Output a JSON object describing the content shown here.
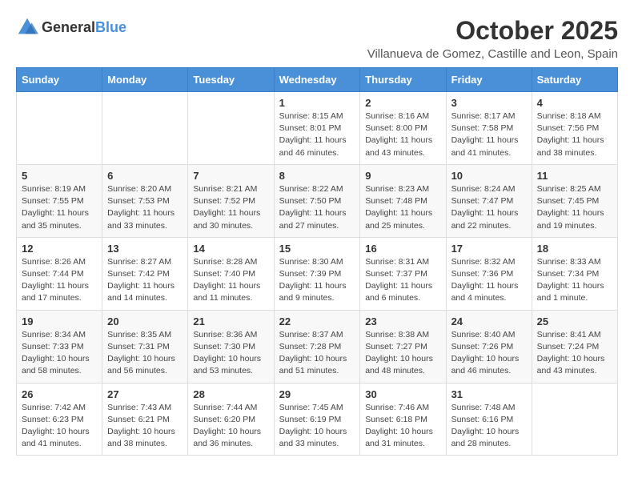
{
  "logo": {
    "general": "General",
    "blue": "Blue"
  },
  "header": {
    "month": "October 2025",
    "location": "Villanueva de Gomez, Castille and Leon, Spain"
  },
  "weekdays": [
    "Sunday",
    "Monday",
    "Tuesday",
    "Wednesday",
    "Thursday",
    "Friday",
    "Saturday"
  ],
  "weeks": [
    [
      {
        "day": "",
        "content": ""
      },
      {
        "day": "",
        "content": ""
      },
      {
        "day": "",
        "content": ""
      },
      {
        "day": "1",
        "content": "Sunrise: 8:15 AM\nSunset: 8:01 PM\nDaylight: 11 hours and 46 minutes."
      },
      {
        "day": "2",
        "content": "Sunrise: 8:16 AM\nSunset: 8:00 PM\nDaylight: 11 hours and 43 minutes."
      },
      {
        "day": "3",
        "content": "Sunrise: 8:17 AM\nSunset: 7:58 PM\nDaylight: 11 hours and 41 minutes."
      },
      {
        "day": "4",
        "content": "Sunrise: 8:18 AM\nSunset: 7:56 PM\nDaylight: 11 hours and 38 minutes."
      }
    ],
    [
      {
        "day": "5",
        "content": "Sunrise: 8:19 AM\nSunset: 7:55 PM\nDaylight: 11 hours and 35 minutes."
      },
      {
        "day": "6",
        "content": "Sunrise: 8:20 AM\nSunset: 7:53 PM\nDaylight: 11 hours and 33 minutes."
      },
      {
        "day": "7",
        "content": "Sunrise: 8:21 AM\nSunset: 7:52 PM\nDaylight: 11 hours and 30 minutes."
      },
      {
        "day": "8",
        "content": "Sunrise: 8:22 AM\nSunset: 7:50 PM\nDaylight: 11 hours and 27 minutes."
      },
      {
        "day": "9",
        "content": "Sunrise: 8:23 AM\nSunset: 7:48 PM\nDaylight: 11 hours and 25 minutes."
      },
      {
        "day": "10",
        "content": "Sunrise: 8:24 AM\nSunset: 7:47 PM\nDaylight: 11 hours and 22 minutes."
      },
      {
        "day": "11",
        "content": "Sunrise: 8:25 AM\nSunset: 7:45 PM\nDaylight: 11 hours and 19 minutes."
      }
    ],
    [
      {
        "day": "12",
        "content": "Sunrise: 8:26 AM\nSunset: 7:44 PM\nDaylight: 11 hours and 17 minutes."
      },
      {
        "day": "13",
        "content": "Sunrise: 8:27 AM\nSunset: 7:42 PM\nDaylight: 11 hours and 14 minutes."
      },
      {
        "day": "14",
        "content": "Sunrise: 8:28 AM\nSunset: 7:40 PM\nDaylight: 11 hours and 11 minutes."
      },
      {
        "day": "15",
        "content": "Sunrise: 8:30 AM\nSunset: 7:39 PM\nDaylight: 11 hours and 9 minutes."
      },
      {
        "day": "16",
        "content": "Sunrise: 8:31 AM\nSunset: 7:37 PM\nDaylight: 11 hours and 6 minutes."
      },
      {
        "day": "17",
        "content": "Sunrise: 8:32 AM\nSunset: 7:36 PM\nDaylight: 11 hours and 4 minutes."
      },
      {
        "day": "18",
        "content": "Sunrise: 8:33 AM\nSunset: 7:34 PM\nDaylight: 11 hours and 1 minute."
      }
    ],
    [
      {
        "day": "19",
        "content": "Sunrise: 8:34 AM\nSunset: 7:33 PM\nDaylight: 10 hours and 58 minutes."
      },
      {
        "day": "20",
        "content": "Sunrise: 8:35 AM\nSunset: 7:31 PM\nDaylight: 10 hours and 56 minutes."
      },
      {
        "day": "21",
        "content": "Sunrise: 8:36 AM\nSunset: 7:30 PM\nDaylight: 10 hours and 53 minutes."
      },
      {
        "day": "22",
        "content": "Sunrise: 8:37 AM\nSunset: 7:28 PM\nDaylight: 10 hours and 51 minutes."
      },
      {
        "day": "23",
        "content": "Sunrise: 8:38 AM\nSunset: 7:27 PM\nDaylight: 10 hours and 48 minutes."
      },
      {
        "day": "24",
        "content": "Sunrise: 8:40 AM\nSunset: 7:26 PM\nDaylight: 10 hours and 46 minutes."
      },
      {
        "day": "25",
        "content": "Sunrise: 8:41 AM\nSunset: 7:24 PM\nDaylight: 10 hours and 43 minutes."
      }
    ],
    [
      {
        "day": "26",
        "content": "Sunrise: 7:42 AM\nSunset: 6:23 PM\nDaylight: 10 hours and 41 minutes."
      },
      {
        "day": "27",
        "content": "Sunrise: 7:43 AM\nSunset: 6:21 PM\nDaylight: 10 hours and 38 minutes."
      },
      {
        "day": "28",
        "content": "Sunrise: 7:44 AM\nSunset: 6:20 PM\nDaylight: 10 hours and 36 minutes."
      },
      {
        "day": "29",
        "content": "Sunrise: 7:45 AM\nSunset: 6:19 PM\nDaylight: 10 hours and 33 minutes."
      },
      {
        "day": "30",
        "content": "Sunrise: 7:46 AM\nSunset: 6:18 PM\nDaylight: 10 hours and 31 minutes."
      },
      {
        "day": "31",
        "content": "Sunrise: 7:48 AM\nSunset: 6:16 PM\nDaylight: 10 hours and 28 minutes."
      },
      {
        "day": "",
        "content": ""
      }
    ]
  ]
}
